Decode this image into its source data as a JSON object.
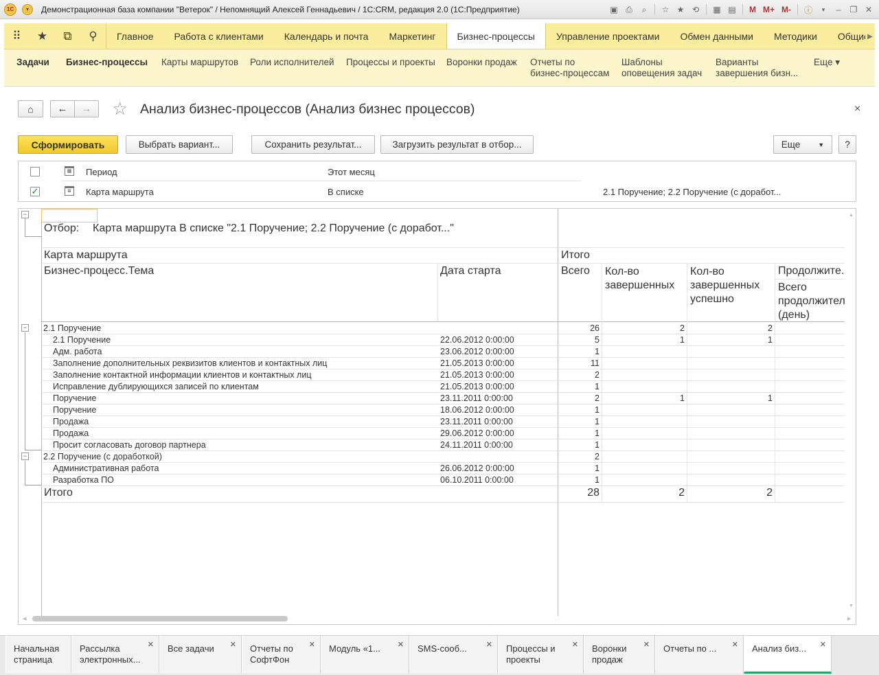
{
  "window": {
    "title": "Демонстрационная база компании \"Ветерок\" / Непомнящий Алексей Геннадьевич / 1С:CRM, редакция 2.0  (1С:Предприятие)",
    "logo_text": "1С",
    "icons": [
      "save-icon",
      "print-icon",
      "preview-icon",
      "favorites-add-icon",
      "favorites-icon",
      "history-icon",
      "calculator-icon",
      "calendar-icon"
    ],
    "memory_buttons": [
      "M",
      "M+",
      "M-"
    ]
  },
  "sections": {
    "items": [
      "Главное",
      "Работа с клиентами",
      "Календарь и почта",
      "Маркетинг",
      "Бизнес-процессы",
      "Управление проектами",
      "Обмен данными",
      "Методики",
      "Общие настро"
    ],
    "active_index": 4
  },
  "subnav": {
    "items": [
      {
        "line1": "Задачи",
        "line2": ""
      },
      {
        "line1": "Бизнес-процессы",
        "line2": ""
      },
      {
        "line1": "Карты маршрутов",
        "line2": ""
      },
      {
        "line1": "Роли исполнителей",
        "line2": ""
      },
      {
        "line1": "Процессы и проекты",
        "line2": ""
      },
      {
        "line1": "Воронки продаж",
        "line2": ""
      },
      {
        "line1": "Отчеты по",
        "line2": "бизнес-процессам"
      },
      {
        "line1": "Шаблоны",
        "line2": "оповещения задач"
      },
      {
        "line1": "Варианты",
        "line2": "завершения бизн..."
      },
      {
        "line1": "Еще ▾",
        "line2": ""
      }
    ]
  },
  "form": {
    "title": "Анализ бизнес-процессов (Анализ бизнес процессов)",
    "close": "×",
    "buttons": {
      "generate": "Сформировать",
      "choose_variant": "Выбрать вариант...",
      "save_result": "Сохранить результат...",
      "load_result": "Загрузить результат в отбор...",
      "more": "Еще",
      "help": "?"
    }
  },
  "settings": [
    {
      "checked": false,
      "name": "Период",
      "condition": "Этот месяц",
      "value": ""
    },
    {
      "checked": true,
      "name": "Карта маршрута",
      "condition": "В списке",
      "value": "2.1 Поручение; 2.2 Поручение  (с доработ..."
    }
  ],
  "report": {
    "filter_label": "Отбор:",
    "filter_text": "Карта маршрута В списке \"2.1 Поручение; 2.2 Поручение  (с доработ...\"",
    "header": {
      "group": "Карта маршрута",
      "topic": "Бизнес-процесс.Тема",
      "date": "Дата старта",
      "total_group": "Итого",
      "col_total": "Всего",
      "col_completed": [
        "Кол-во",
        "завершенных"
      ],
      "col_success": [
        "Кол-во",
        "завершенных",
        "успешно"
      ],
      "col_duration": "Продолжите...",
      "col_duration_sub": [
        "Всего",
        "продолжител...",
        "(день)"
      ]
    },
    "groups": [
      {
        "name": "2.1 Поручение",
        "total": "26",
        "completed": "2",
        "success": "2",
        "rows": [
          {
            "topic": "2.1 Поручение",
            "date": "22.06.2012 0:00:00",
            "total": "5",
            "completed": "1",
            "success": "1"
          },
          {
            "topic": "Адм. работа",
            "date": "23.06.2012 0:00:00",
            "total": "1",
            "completed": "",
            "success": ""
          },
          {
            "topic": "Заполнение дополнительных реквизитов клиентов и контактных лиц",
            "date": "21.05.2013 0:00:00",
            "total": "11",
            "completed": "",
            "success": ""
          },
          {
            "topic": "Заполнение контактной информации клиентов и контактных лиц",
            "date": "21.05.2013 0:00:00",
            "total": "2",
            "completed": "",
            "success": ""
          },
          {
            "topic": "Исправление дублирующихся записей по клиентам",
            "date": "21.05.2013 0:00:00",
            "total": "1",
            "completed": "",
            "success": ""
          },
          {
            "topic": "Поручение",
            "date": "23.11.2011 0:00:00",
            "total": "2",
            "completed": "1",
            "success": "1"
          },
          {
            "topic": "Поручение",
            "date": "18.06.2012 0:00:00",
            "total": "1",
            "completed": "",
            "success": ""
          },
          {
            "topic": "Продажа",
            "date": "23.11.2011 0:00:00",
            "total": "1",
            "completed": "",
            "success": ""
          },
          {
            "topic": "Продажа",
            "date": "29.06.2012 0:00:00",
            "total": "1",
            "completed": "",
            "success": ""
          },
          {
            "topic": "Просит согласовать договор партнера",
            "date": "24.11.2011 0:00:00",
            "total": "1",
            "completed": "",
            "success": ""
          }
        ]
      },
      {
        "name": "2.2 Поручение  (с доработкой)",
        "total": "2",
        "completed": "",
        "success": "",
        "rows": [
          {
            "topic": "Административная работа",
            "date": "26.06.2012 0:00:00",
            "total": "1",
            "completed": "",
            "success": ""
          },
          {
            "topic": "Разработка ПО",
            "date": "06.10.2011 0:00:00",
            "total": "1",
            "completed": "",
            "success": ""
          }
        ]
      }
    ],
    "grand_total": {
      "label": "Итого",
      "total": "28",
      "completed": "2",
      "success": "2"
    }
  },
  "tabs": [
    {
      "line1": "Начальная",
      "line2": "страница",
      "closable": false
    },
    {
      "line1": "Рассылка",
      "line2": "электронных...",
      "closable": true
    },
    {
      "line1": "Все задачи",
      "line2": "",
      "closable": true
    },
    {
      "line1": "Отчеты по",
      "line2": "СофтФон",
      "closable": true
    },
    {
      "line1": "Модуль «1...",
      "line2": "",
      "closable": true
    },
    {
      "line1": "SMS-сооб...",
      "line2": "",
      "closable": true
    },
    {
      "line1": "Процессы и",
      "line2": "проекты",
      "closable": true
    },
    {
      "line1": "Воронки",
      "line2": "продаж",
      "closable": true
    },
    {
      "line1": "Отчеты по ...",
      "line2": "",
      "closable": true
    },
    {
      "line1": "Анализ биз...",
      "line2": "",
      "closable": true
    }
  ],
  "active_tab": 9
}
